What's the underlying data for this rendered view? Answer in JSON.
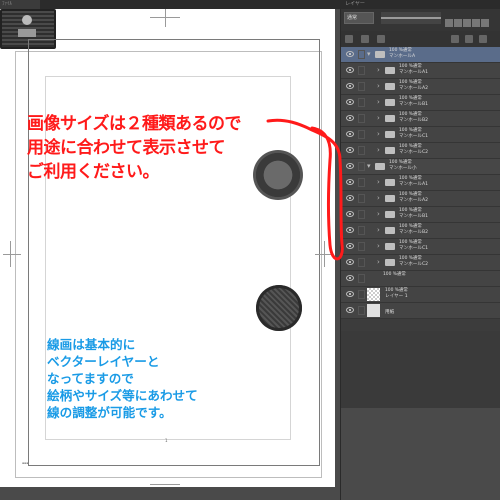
{
  "window": {
    "left_tab": "ﾌｧｲﾙ",
    "panel_title": "レイヤー"
  },
  "canvas": {
    "red_note_lines": [
      "画像サイズは２種類あるので",
      "用途に合わせて表示させて",
      "ご利用ください。"
    ],
    "blue_note_lines": [
      "線画は基本的に",
      "ベクターレイヤーと",
      "なってますので",
      "絵柄やサイズ等にあわせて",
      "線の調整が可能です。"
    ],
    "page_number": "1",
    "accent_red": "#ff1a1a",
    "accent_blue": "#1a9be6"
  },
  "layer_panel": {
    "blend_mode": "通常",
    "layers": [
      {
        "indent": 0,
        "kind": "folder-group",
        "line1": "100 %通常",
        "line2": "マンホールA",
        "selected": true
      },
      {
        "indent": 1,
        "kind": "folder",
        "line1": "100 %通常",
        "line2": "マンホールA1"
      },
      {
        "indent": 1,
        "kind": "folder",
        "line1": "100 %通常",
        "line2": "マンホールA2"
      },
      {
        "indent": 1,
        "kind": "folder",
        "line1": "100 %通常",
        "line2": "マンホールB1"
      },
      {
        "indent": 1,
        "kind": "folder",
        "line1": "100 %通常",
        "line2": "マンホールB2"
      },
      {
        "indent": 1,
        "kind": "folder",
        "line1": "100 %通常",
        "line2": "マンホールC1"
      },
      {
        "indent": 1,
        "kind": "folder",
        "line1": "100 %通常",
        "line2": "マンホールC2"
      },
      {
        "indent": 0,
        "kind": "folder-group",
        "line1": "100 %通常",
        "line2": "マンホール小"
      },
      {
        "indent": 1,
        "kind": "folder",
        "line1": "100 %通常",
        "line2": "マンホールA1"
      },
      {
        "indent": 1,
        "kind": "folder",
        "line1": "100 %通常",
        "line2": "マンホールA2"
      },
      {
        "indent": 1,
        "kind": "folder",
        "line1": "100 %通常",
        "line2": "マンホールB1"
      },
      {
        "indent": 1,
        "kind": "folder",
        "line1": "100 %通常",
        "line2": "マンホールB2"
      },
      {
        "indent": 1,
        "kind": "folder",
        "line1": "100 %通常",
        "line2": "マンホールC1"
      },
      {
        "indent": 1,
        "kind": "folder",
        "line1": "100 %通常",
        "line2": "マンホールC2"
      },
      {
        "indent": 0,
        "kind": "plain",
        "line1": "100 %通常",
        "line2": ""
      },
      {
        "indent": 0,
        "kind": "raster",
        "line1": "100 %通常",
        "line2": "レイヤー 1"
      },
      {
        "indent": 0,
        "kind": "paper",
        "line1": "",
        "line2": "用紙"
      }
    ]
  }
}
